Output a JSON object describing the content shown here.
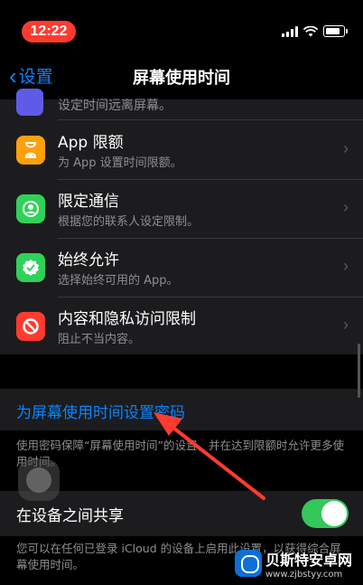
{
  "status_bar": {
    "time": "12:22"
  },
  "nav": {
    "back_label": "设置",
    "title": "屏幕使用时间"
  },
  "partial_row": {
    "subtitle": "设定时间远离屏幕。"
  },
  "rows": [
    {
      "title": "App 限额",
      "subtitle": "为 App 设置时间限额。",
      "icon": "hourglass-icon",
      "color": "#ff9f0a"
    },
    {
      "title": "限定通信",
      "subtitle": "根据您的联系人设定限制。",
      "icon": "person-circle-icon",
      "color": "#30d158"
    },
    {
      "title": "始终允许",
      "subtitle": "选择始终可用的 App。",
      "icon": "checkmark-seal-icon",
      "color": "#30d158"
    },
    {
      "title": "内容和隐私访问限制",
      "subtitle": "阻止不当内容。",
      "icon": "prohibited-icon",
      "color": "#ff3b30"
    }
  ],
  "passcode": {
    "label": "为屏幕使用时间设置密码",
    "footer": "使用密码保障“屏幕使用时间”的设置，并在达到限额时允许更多使用时间。"
  },
  "share": {
    "label": "在设备之间共享",
    "enabled": true,
    "footer": "您可以在任何已登录 iCloud 的设备上启用此设置，以获得综合屏幕使用时间。"
  },
  "colors": {
    "accent": "#0a84ff",
    "toggle_on": "#34c759",
    "annotation_arrow": "#ff3b30"
  },
  "watermark": {
    "title": "贝斯特安卓网",
    "url": "www.zjbstyy.com"
  }
}
